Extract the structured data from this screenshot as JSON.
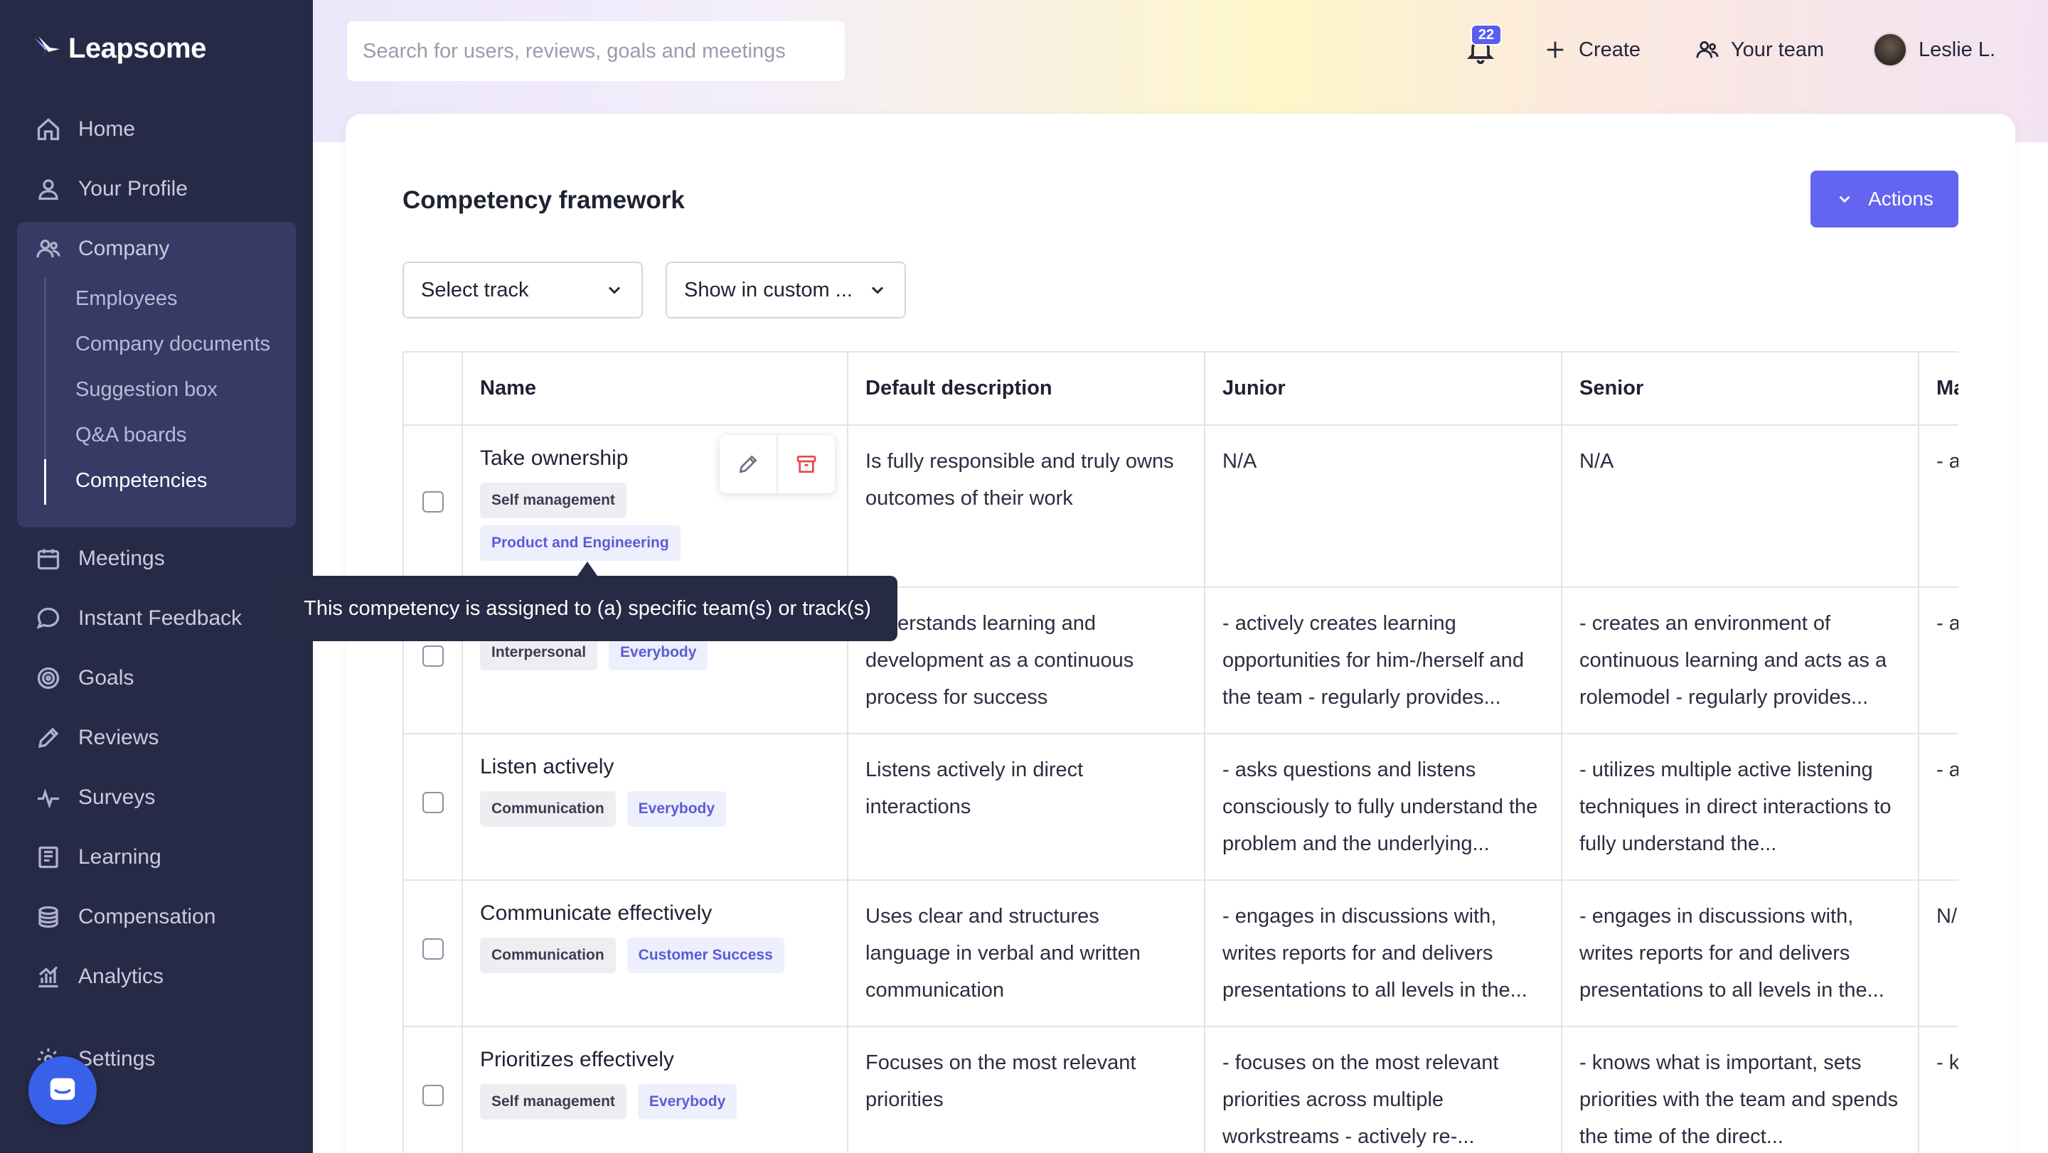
{
  "brand": {
    "name": "Leapsome"
  },
  "sidebar": {
    "items": [
      {
        "label": "Home",
        "icon": "home-icon"
      },
      {
        "label": "Your Profile",
        "icon": "user-icon"
      },
      {
        "label": "Company",
        "icon": "users-icon"
      },
      {
        "label": "Meetings",
        "icon": "calendar-icon"
      },
      {
        "label": "Instant Feedback",
        "icon": "chat-icon"
      },
      {
        "label": "Goals",
        "icon": "target-icon"
      },
      {
        "label": "Reviews",
        "icon": "pen-icon"
      },
      {
        "label": "Surveys",
        "icon": "pulse-icon"
      },
      {
        "label": "Learning",
        "icon": "book-icon"
      },
      {
        "label": "Compensation",
        "icon": "coins-icon"
      },
      {
        "label": "Analytics",
        "icon": "chart-icon"
      },
      {
        "label": "Settings",
        "icon": "gear-icon"
      }
    ],
    "company_sub": [
      "Employees",
      "Company documents",
      "Suggestion box",
      "Q&A boards",
      "Competencies"
    ],
    "active_sub": "Competencies"
  },
  "topbar": {
    "search_placeholder": "Search for users, reviews, goals and meetings",
    "notifications_count": "22",
    "create_label": "Create",
    "team_label": "Your team",
    "user_name": "Leslie L."
  },
  "page": {
    "title": "Competency framework",
    "actions_label": "Actions",
    "filter_track": "Select track",
    "filter_view": "Show in custom ..."
  },
  "table": {
    "headers": [
      "Name",
      "Default description",
      "Junior",
      "Senior",
      "Ma"
    ],
    "rows": [
      {
        "name": "Take ownership",
        "category": "Self management",
        "team": "Product and Engineering",
        "description": "Is fully responsible and truly owns outcomes of their work",
        "junior": "N/A",
        "senior": "N/A",
        "next": "- a ow"
      },
      {
        "name": "",
        "category": "Interpersonal",
        "team": "Everybody",
        "description": "…derstands learning and development as a continuous process for success",
        "junior": "- actively creates learning opportunities for him-/herself and the team - regularly provides...",
        "senior": "- creates an environment of continuous learning and acts as a rolemodel - regularly provides...",
        "next": "- a op gr"
      },
      {
        "name": "Listen actively",
        "category": "Communication",
        "team": "Everybody",
        "description": "Listens actively in direct interactions",
        "junior": "- asks questions and listens consciously to fully understand the problem and the underlying...",
        "senior": "- utilizes multiple active listening techniques in direct interactions to fully understand the...",
        "next": "- a co the"
      },
      {
        "name": "Communicate effectively",
        "category": "Communication",
        "team": "Customer Success",
        "description": "Uses clear and structures language in verbal and written communication",
        "junior": "- engages in discussions with, writes reports for and delivers presentations to all levels in the...",
        "senior": "- engages in discussions with, writes reports for and delivers presentations to all levels in the...",
        "next": "N/"
      },
      {
        "name": "Prioritizes effectively",
        "category": "Self management",
        "team": "Everybody",
        "description": "Focuses on the most relevant priorities",
        "junior": "- focuses on the most relevant priorities across multiple workstreams - actively re-...",
        "senior": "- knows what is important, sets priorities with the team and spends the time of the direct...",
        "next": "- k ca his"
      }
    ]
  },
  "tooltip": {
    "text": "This competency is assigned to (a) specific team(s) or track(s)"
  },
  "colors": {
    "sidebar_bg": "#272a46",
    "accent": "#6365f1",
    "tooltip_bg": "#262a44"
  }
}
